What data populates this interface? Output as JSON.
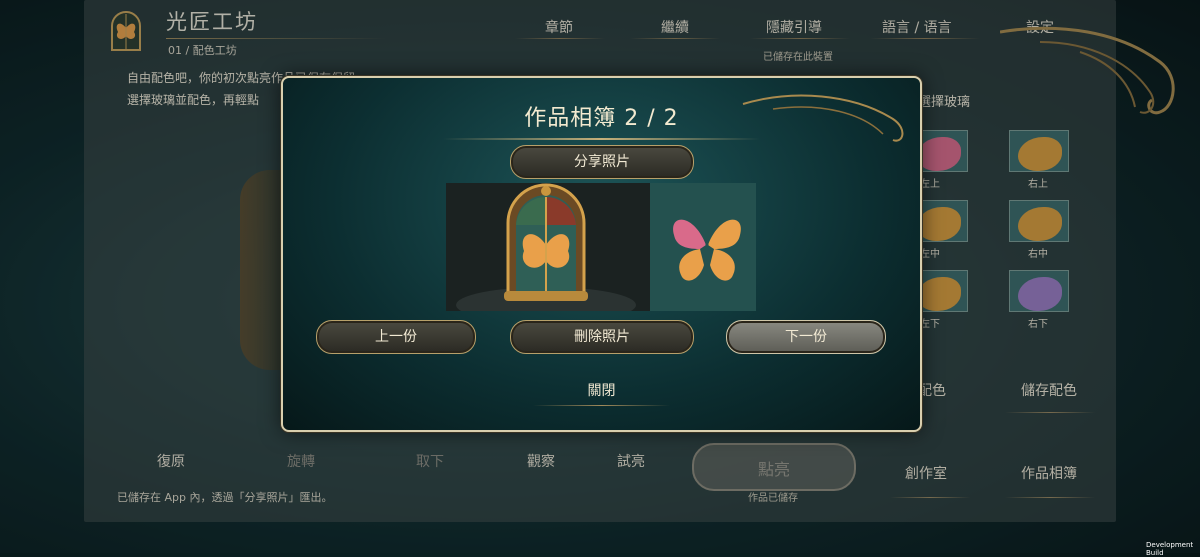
{
  "header": {
    "title": "光匠工坊",
    "subtitle": "01 / 配色工坊",
    "nav": [
      "章節",
      "繼續",
      "隱藏引導",
      "語言 / 语言",
      "設定"
    ],
    "saved_device": "已儲存在此裝置"
  },
  "hints": {
    "line1": "自由配色吧，你的初次點亮作品已保存保留",
    "line2": "選擇玻璃並配色，再輕點"
  },
  "side_panel": {
    "title": "選擇玻璃",
    "swatches": [
      {
        "label": "左上"
      },
      {
        "label": "右上"
      },
      {
        "label": "左中"
      },
      {
        "label": "右中"
      },
      {
        "label": "左下"
      },
      {
        "label": "右下"
      }
    ],
    "color_label": "配色",
    "save_color": "儲存配色"
  },
  "bottom_bar": {
    "restore": "復原",
    "rotate": "旋轉",
    "remove": "取下",
    "observe": "觀察",
    "test_light": "試亮",
    "light_up": "點亮",
    "work_saved": "作品已儲存",
    "studio": "創作室",
    "album": "作品相簿",
    "footer_note": "已儲存在 App 內，透過「分享照片」匯出。"
  },
  "modal": {
    "title": "作品相簿 2 / 2",
    "share": "分享照片",
    "prev": "上一份",
    "delete": "刪除照片",
    "next": "下一份",
    "close": "關閉"
  },
  "dev_build": "Development Build",
  "colors": {
    "accent_gold": "#c6b07a",
    "wing_orange": "#e9a04a",
    "wing_pink": "#d96a8a",
    "teal_bg": "#1d5457"
  }
}
